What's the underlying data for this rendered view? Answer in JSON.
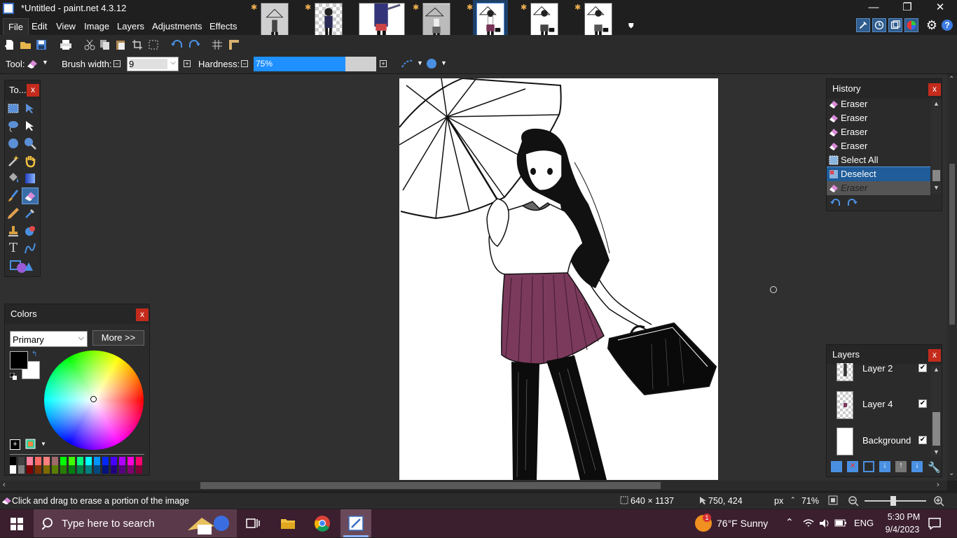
{
  "app": {
    "title": "*Untitled - paint.net 4.3.12",
    "window_buttons": [
      "minimize",
      "restore",
      "close"
    ]
  },
  "menu": [
    "File",
    "Edit",
    "View",
    "Image",
    "Layers",
    "Adjustments",
    "Effects"
  ],
  "toolbar": {
    "tool_label": "Tool:",
    "brush_width_label": "Brush width:",
    "brush_width_value": "9",
    "hardness_label": "Hardness:",
    "hardness_value": "75%",
    "hardness_level": 0.75
  },
  "tools_panel": {
    "title": "To..."
  },
  "colors_panel": {
    "title": "Colors",
    "mode": "Primary",
    "more_button": "More >>",
    "primary_color": "#000000",
    "secondary_color": "#ffffff"
  },
  "history_panel": {
    "title": "History",
    "items": [
      "Eraser",
      "Eraser",
      "Eraser",
      "Eraser",
      "Select All",
      "Deselect",
      "Eraser"
    ],
    "selected_index": 5
  },
  "layers_panel": {
    "title": "Layers",
    "layers": [
      "Layer 2",
      "Layer 4",
      "Background"
    ]
  },
  "status": {
    "hint": "Click and drag to erase a portion of the image",
    "image_size": "640 × 1137",
    "cursor_pos": "750, 424",
    "units": "px",
    "zoom": "71%"
  },
  "taskbar": {
    "search_placeholder": "Type here to search",
    "weather": "76°F  Sunny",
    "weather_badge": "1",
    "lang": "ENG",
    "time": "5:30 PM",
    "date": "9/4/2023"
  },
  "colors": {
    "accent": "#0078d7",
    "hardness_fill": "#1e90ff",
    "close_red": "#c42b1c",
    "selection": "#1f5c99"
  }
}
